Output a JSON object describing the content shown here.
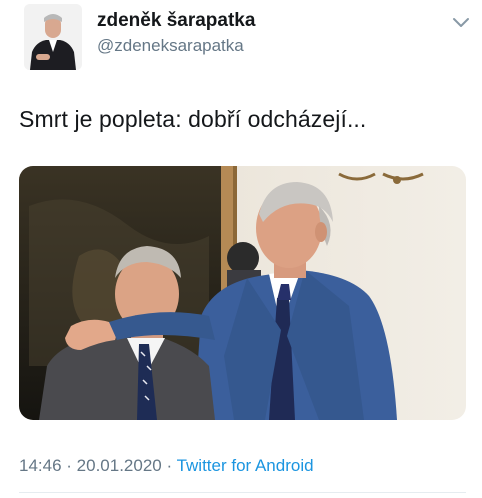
{
  "tweet": {
    "author": {
      "display_name": "zdeněk šarapatka",
      "handle": "@zdeneksarapatka",
      "avatar_icon": "avatar"
    },
    "menu_icon": "chevron-down-icon",
    "text": "Smrt je popleta: dobří odcházejí...",
    "media": {
      "type": "photo",
      "alt_icon": "photo"
    },
    "meta": {
      "time": "14:46",
      "separator": " · ",
      "date": "20.01.2020",
      "separator2": " · ",
      "source": "Twitter for Android"
    }
  },
  "colors": {
    "text": "#14171a",
    "secondary": "#657786",
    "link": "#1b95e0",
    "divider": "#e6ecf0"
  }
}
